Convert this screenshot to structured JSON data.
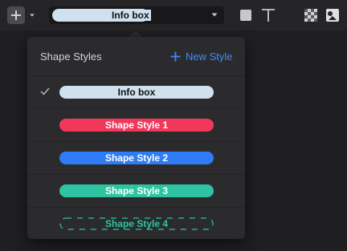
{
  "toolbar": {
    "style_select": {
      "value": "Info box"
    }
  },
  "panel": {
    "title": "Shape Styles",
    "new_style_label": "New Style"
  },
  "styles": [
    {
      "label": "Info box",
      "fill": "#cfe0ef",
      "text_color": "#111111",
      "selected": true,
      "dashed": false
    },
    {
      "label": "Shape Style 1",
      "fill": "#f2385a",
      "text_color": "#ffffff",
      "selected": false,
      "dashed": false
    },
    {
      "label": "Shape Style 2",
      "fill": "#2f7cf6",
      "text_color": "#ffffff",
      "selected": false,
      "dashed": false
    },
    {
      "label": "Shape Style 3",
      "fill": "#2fc4a1",
      "text_color": "#ffffff",
      "selected": false,
      "dashed": false
    },
    {
      "label": "Shape Style 4",
      "fill": "transparent",
      "stroke": "#2fc4a1",
      "text_color": "#2fc4a1",
      "selected": false,
      "dashed": true
    }
  ],
  "colors": {
    "accent": "#3b8cff",
    "panel_bg": "#2b2b2e",
    "toolbar_bg": "#252528"
  }
}
